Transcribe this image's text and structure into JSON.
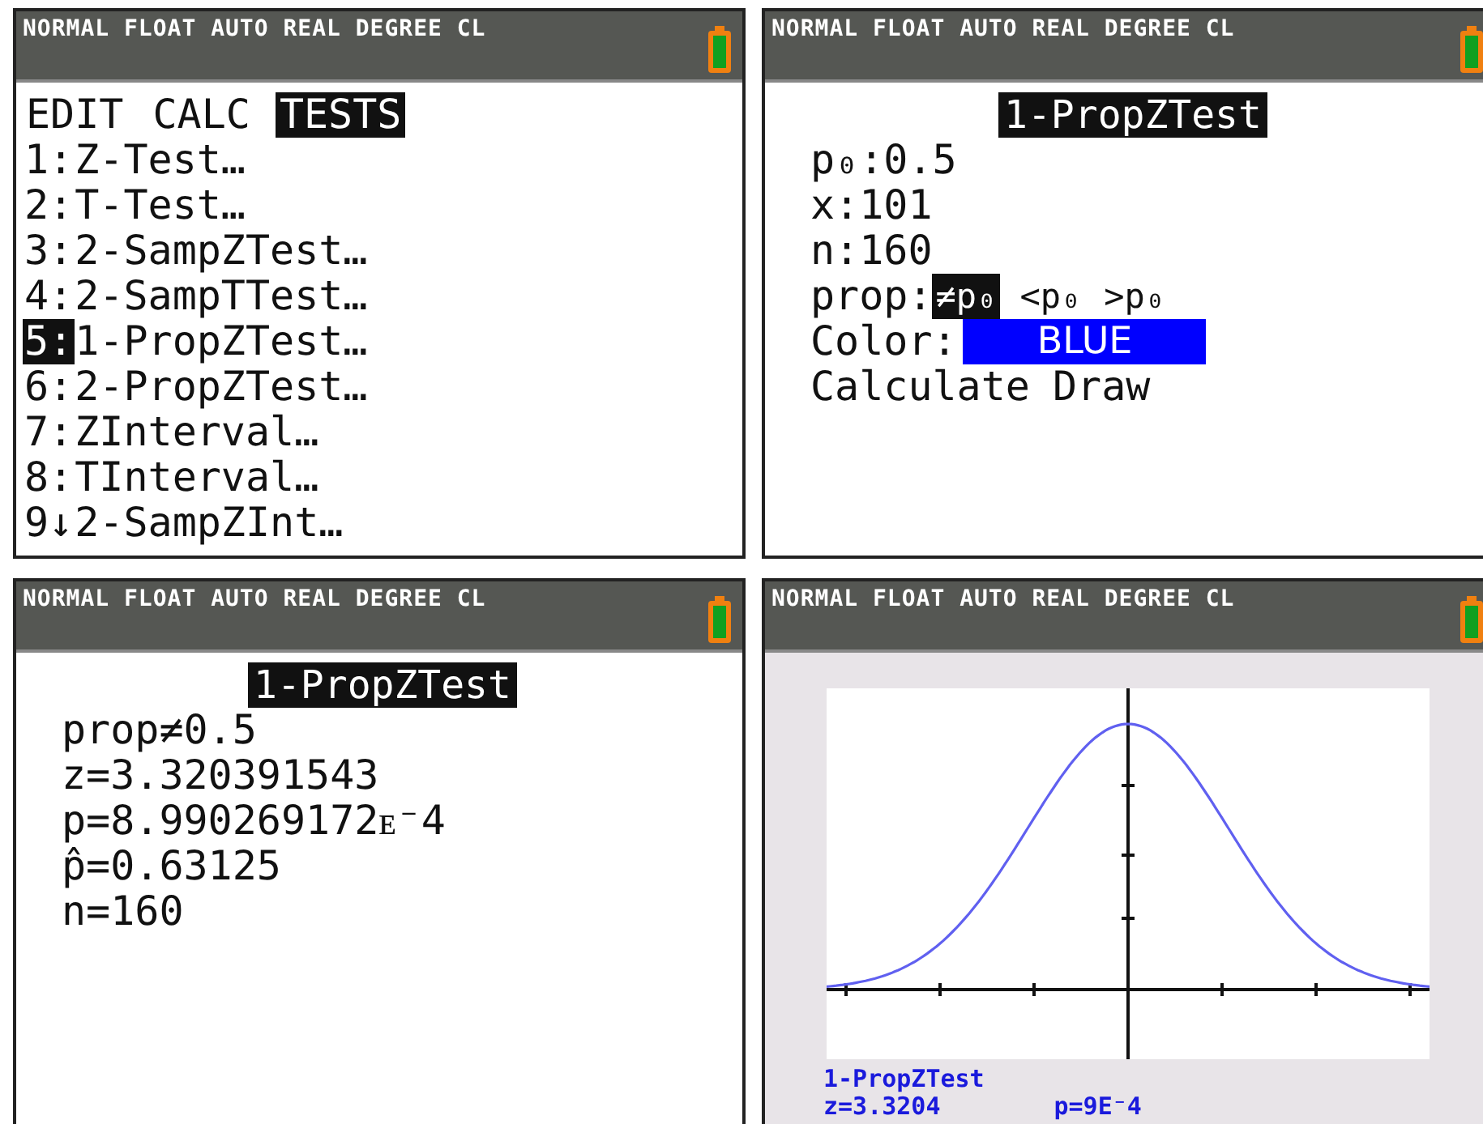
{
  "screens": [
    {
      "kind": "menu",
      "status": "NORMAL FLOAT AUTO REAL DEGREE CL",
      "tabs": [
        {
          "label": "EDIT",
          "selected": false
        },
        {
          "label": "CALC",
          "selected": false
        },
        {
          "label": "TESTS",
          "selected": true
        }
      ],
      "items": [
        {
          "key": "1:",
          "label": "Z-Test…",
          "selected": false
        },
        {
          "key": "2:",
          "label": "T-Test…",
          "selected": false
        },
        {
          "key": "3:",
          "label": "2-SampZTest…",
          "selected": false
        },
        {
          "key": "4:",
          "label": "2-SampTTest…",
          "selected": false
        },
        {
          "key": "5:",
          "label": "1-PropZTest…",
          "selected": true
        },
        {
          "key": "6:",
          "label": "2-PropZTest…",
          "selected": false
        },
        {
          "key": "7:",
          "label": "ZInterval…",
          "selected": false
        },
        {
          "key": "8:",
          "label": "TInterval…",
          "selected": false
        },
        {
          "key": "9↓",
          "label": "2-SampZInt…",
          "selected": false
        }
      ]
    },
    {
      "kind": "form",
      "status": "NORMAL FLOAT AUTO REAL DEGREE CL",
      "title": "1-PropZTest",
      "fields": [
        {
          "label": "p₀:",
          "value": "0.5"
        },
        {
          "label": "x:",
          "value": "101"
        },
        {
          "label": "n:",
          "value": "160"
        }
      ],
      "prop": {
        "label": "prop:",
        "options": [
          {
            "label": "≠p₀",
            "selected": true
          },
          {
            "label": "<p₀",
            "selected": false
          },
          {
            "label": ">p₀",
            "selected": false
          }
        ]
      },
      "color": {
        "label": "Color:",
        "value": "BLUE",
        "color": "#0000ff"
      },
      "actions": [
        "Calculate",
        "Draw"
      ]
    },
    {
      "kind": "results",
      "status": "NORMAL FLOAT AUTO REAL DEGREE CL",
      "title": "1-PropZTest",
      "lines": [
        "prop≠0.5",
        "z=3.320391543",
        "p=8.990269172ᴇ⁻4",
        "p̂=0.63125",
        "n=160"
      ]
    },
    {
      "kind": "graph",
      "status": "NORMAL FLOAT AUTO REAL DEGREE CL",
      "footer": {
        "title": "1-PropZTest",
        "z": "z=3.3204",
        "p": "p=9E⁻4"
      }
    }
  ]
}
